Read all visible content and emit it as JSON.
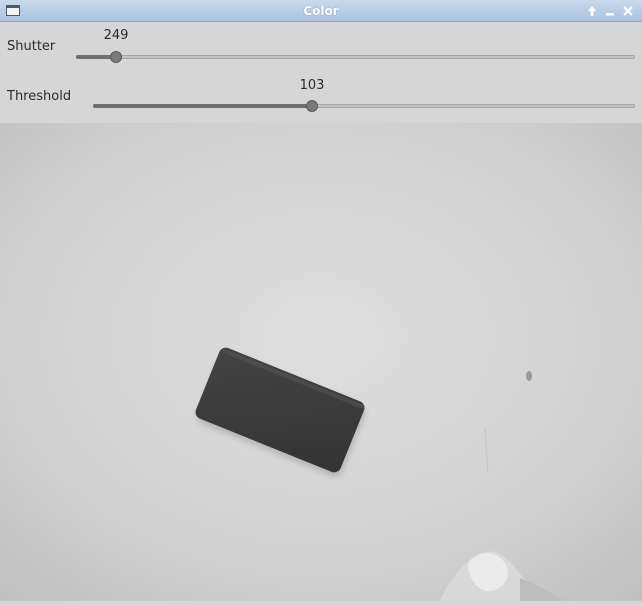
{
  "window": {
    "title": "Color",
    "buttons": [
      "maximize-icon",
      "minimize-icon",
      "close-icon"
    ],
    "titlebar_color": "#b5cce6"
  },
  "controls": {
    "shutter": {
      "label": "Shutter",
      "value": "249",
      "fraction": 0.072
    },
    "threshold": {
      "label": "Threshold",
      "value": "103",
      "fraction": 0.404
    }
  },
  "camera_view": {
    "content": "grayscale camera feed",
    "colors": {
      "surface": "#d8d8d8",
      "object": "#3c3c3c"
    }
  }
}
